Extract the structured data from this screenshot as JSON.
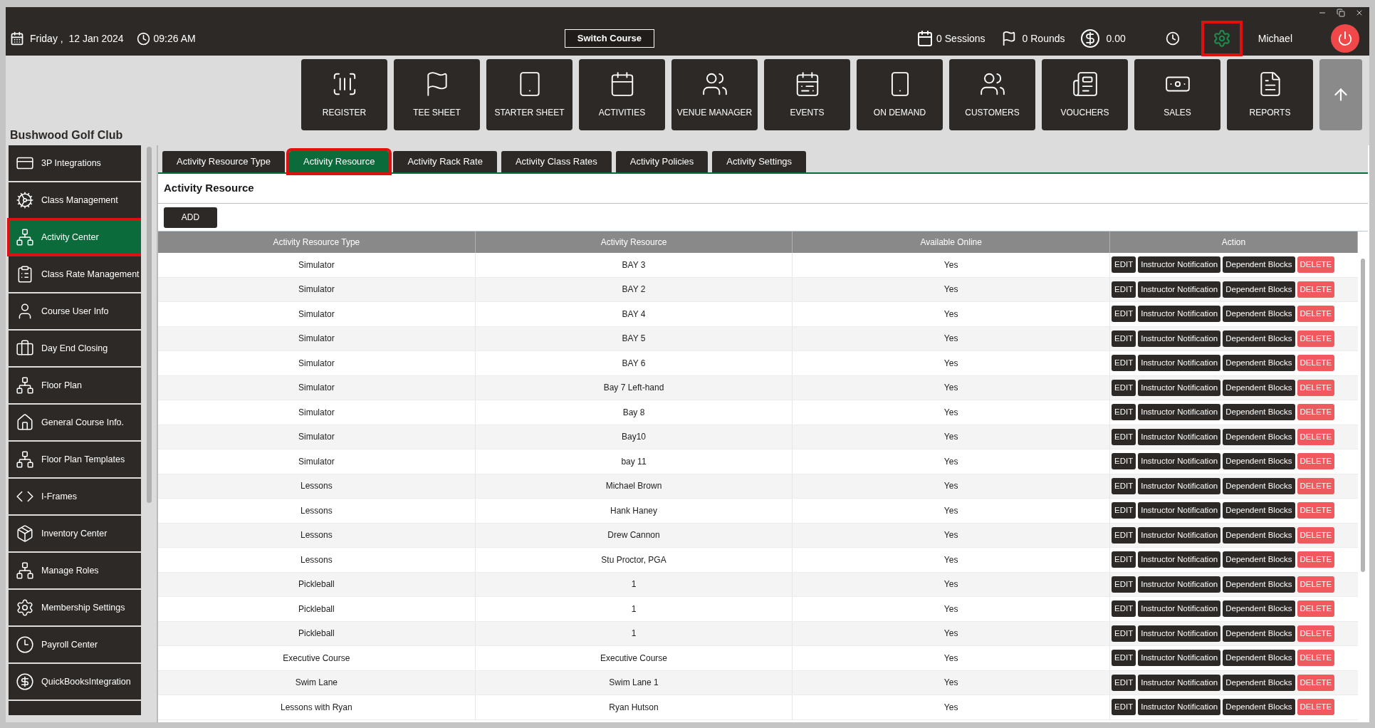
{
  "top_bar": {
    "date": "Friday ,  12 Jan 2024",
    "time": "09:26 AM",
    "switch_course": "Switch Course",
    "sessions": "0 Sessions",
    "rounds": "0 Rounds",
    "balance": "0.00",
    "settings_highlighted": true,
    "user": "Michael"
  },
  "toolbar": [
    {
      "label": "REGISTER",
      "kind": "scanner"
    },
    {
      "label": "TEE SHEET",
      "kind": "flag"
    },
    {
      "label": "STARTER SHEET",
      "kind": "tablet"
    },
    {
      "label": "ACTIVITIES",
      "kind": "calendar"
    },
    {
      "label": "VENUE MANAGER",
      "kind": "people"
    },
    {
      "label": "EVENTS",
      "kind": "events"
    },
    {
      "label": "ON DEMAND",
      "kind": "phone"
    },
    {
      "label": "CUSTOMERS",
      "kind": "group"
    },
    {
      "label": "VOUCHERS",
      "kind": "voucher"
    },
    {
      "label": "SALES",
      "kind": "sales"
    },
    {
      "label": "REPORTS",
      "kind": "report"
    }
  ],
  "club_name": "Bushwood Golf Club",
  "sidebar": {
    "items": [
      {
        "label": "3P Integrations",
        "kind": "card",
        "selected": false,
        "highlighted": false
      },
      {
        "label": "Class Management",
        "kind": "gear",
        "selected": false,
        "highlighted": false
      },
      {
        "label": "Activity  Center",
        "kind": "tree",
        "selected": true,
        "highlighted": true
      },
      {
        "label": "Class Rate Management",
        "kind": "list",
        "selected": false,
        "highlighted": false
      },
      {
        "label": "Course User Info",
        "kind": "user",
        "selected": false,
        "highlighted": false
      },
      {
        "label": "Day End Closing",
        "kind": "case",
        "selected": false,
        "highlighted": false
      },
      {
        "label": "Floor Plan",
        "kind": "tree",
        "selected": false,
        "highlighted": false
      },
      {
        "label": "General Course Info.",
        "kind": "house",
        "selected": false,
        "highlighted": false
      },
      {
        "label": "Floor Plan Templates",
        "kind": "tree",
        "selected": false,
        "highlighted": false
      },
      {
        "label": "I-Frames",
        "kind": "code",
        "selected": false,
        "highlighted": false
      },
      {
        "label": "Inventory Center",
        "kind": "cart",
        "selected": false,
        "highlighted": false
      },
      {
        "label": "Manage Roles",
        "kind": "tree",
        "selected": false,
        "highlighted": false
      },
      {
        "label": "Membership Settings",
        "kind": "gear2",
        "selected": false,
        "highlighted": false
      },
      {
        "label": "Payroll Center",
        "kind": "clock",
        "selected": false,
        "highlighted": false
      },
      {
        "label": "QuickBooksIntegration",
        "kind": "qb",
        "selected": false,
        "highlighted": false
      }
    ]
  },
  "tabs": [
    {
      "label": "Activity Resource Type",
      "selected": false,
      "highlighted": false
    },
    {
      "label": "Activity Resource",
      "selected": true,
      "highlighted": true
    },
    {
      "label": "Activity Rack Rate",
      "selected": false,
      "highlighted": false
    },
    {
      "label": "Activity Class Rates",
      "selected": false,
      "highlighted": false
    },
    {
      "label": "Activity Policies",
      "selected": false,
      "highlighted": false
    },
    {
      "label": "Activity Settings",
      "selected": false,
      "highlighted": false
    }
  ],
  "panel": {
    "title": "Activity Resource",
    "add_button": "ADD"
  },
  "table": {
    "columns": [
      "Activity Resource Type",
      "Activity Resource",
      "Available Online",
      "Action"
    ],
    "rows": [
      {
        "cells": [
          "Simulator",
          "BAY 3",
          "Yes"
        ],
        "actions": [
          {
            "label": "EDIT",
            "kind": "dark"
          },
          {
            "label": "Instructor Notification",
            "kind": "dark"
          },
          {
            "label": "Dependent Blocks",
            "kind": "dark"
          },
          {
            "label": "DELETE",
            "kind": "danger"
          }
        ]
      },
      {
        "cells": [
          "Simulator",
          "BAY 2",
          "Yes"
        ],
        "actions": [
          {
            "label": "EDIT",
            "kind": "dark"
          },
          {
            "label": "Instructor Notification",
            "kind": "dark"
          },
          {
            "label": "Dependent Blocks",
            "kind": "dark"
          },
          {
            "label": "DELETE",
            "kind": "danger"
          }
        ]
      },
      {
        "cells": [
          "Simulator",
          "BAY 4",
          "Yes"
        ],
        "actions": [
          {
            "label": "EDIT",
            "kind": "dark"
          },
          {
            "label": "Instructor Notification",
            "kind": "dark"
          },
          {
            "label": "Dependent Blocks",
            "kind": "dark"
          },
          {
            "label": "DELETE",
            "kind": "danger"
          }
        ]
      },
      {
        "cells": [
          "Simulator",
          "BAY 5",
          "Yes"
        ],
        "actions": [
          {
            "label": "EDIT",
            "kind": "dark"
          },
          {
            "label": "Instructor Notification",
            "kind": "dark"
          },
          {
            "label": "Dependent Blocks",
            "kind": "dark"
          },
          {
            "label": "DELETE",
            "kind": "danger"
          }
        ]
      },
      {
        "cells": [
          "Simulator",
          "BAY 6",
          "Yes"
        ],
        "actions": [
          {
            "label": "EDIT",
            "kind": "dark"
          },
          {
            "label": "Instructor Notification",
            "kind": "dark"
          },
          {
            "label": "Dependent Blocks",
            "kind": "dark"
          },
          {
            "label": "DELETE",
            "kind": "danger"
          }
        ]
      },
      {
        "cells": [
          "Simulator",
          "Bay 7 Left-hand",
          "Yes"
        ],
        "actions": [
          {
            "label": "EDIT",
            "kind": "dark"
          },
          {
            "label": "Instructor Notification",
            "kind": "dark"
          },
          {
            "label": "Dependent Blocks",
            "kind": "dark"
          },
          {
            "label": "DELETE",
            "kind": "danger"
          }
        ]
      },
      {
        "cells": [
          "Simulator",
          "Bay 8",
          "Yes"
        ],
        "actions": [
          {
            "label": "EDIT",
            "kind": "dark"
          },
          {
            "label": "Instructor Notification",
            "kind": "dark"
          },
          {
            "label": "Dependent Blocks",
            "kind": "dark"
          },
          {
            "label": "DELETE",
            "kind": "danger"
          }
        ]
      },
      {
        "cells": [
          "Simulator",
          "Bay10",
          "Yes"
        ],
        "actions": [
          {
            "label": "EDIT",
            "kind": "dark"
          },
          {
            "label": "Instructor Notification",
            "kind": "dark"
          },
          {
            "label": "Dependent Blocks",
            "kind": "dark"
          },
          {
            "label": "DELETE",
            "kind": "danger"
          }
        ]
      },
      {
        "cells": [
          "Simulator",
          "bay 11",
          "Yes"
        ],
        "actions": [
          {
            "label": "EDIT",
            "kind": "dark"
          },
          {
            "label": "Instructor Notification",
            "kind": "dark"
          },
          {
            "label": "Dependent Blocks",
            "kind": "dark"
          },
          {
            "label": "DELETE",
            "kind": "danger"
          }
        ]
      },
      {
        "cells": [
          "Lessons",
          "Michael Brown",
          "Yes"
        ],
        "actions": [
          {
            "label": "EDIT",
            "kind": "dark"
          },
          {
            "label": "Instructor Notification",
            "kind": "dark"
          },
          {
            "label": "Dependent Blocks",
            "kind": "dark"
          },
          {
            "label": "DELETE",
            "kind": "danger"
          }
        ]
      },
      {
        "cells": [
          "Lessons",
          "Hank Haney",
          "Yes"
        ],
        "actions": [
          {
            "label": "EDIT",
            "kind": "dark"
          },
          {
            "label": "Instructor Notification",
            "kind": "dark"
          },
          {
            "label": "Dependent Blocks",
            "kind": "dark"
          },
          {
            "label": "DELETE",
            "kind": "danger"
          }
        ]
      },
      {
        "cells": [
          "Lessons",
          "Drew Cannon",
          "Yes"
        ],
        "actions": [
          {
            "label": "EDIT",
            "kind": "dark"
          },
          {
            "label": "Instructor Notification",
            "kind": "dark"
          },
          {
            "label": "Dependent Blocks",
            "kind": "dark"
          },
          {
            "label": "DELETE",
            "kind": "danger"
          }
        ]
      },
      {
        "cells": [
          "Lessons",
          "Stu Proctor, PGA",
          "Yes"
        ],
        "actions": [
          {
            "label": "EDIT",
            "kind": "dark"
          },
          {
            "label": "Instructor Notification",
            "kind": "dark"
          },
          {
            "label": "Dependent Blocks",
            "kind": "dark"
          },
          {
            "label": "DELETE",
            "kind": "danger"
          }
        ]
      },
      {
        "cells": [
          "Pickleball",
          "1",
          "Yes"
        ],
        "actions": [
          {
            "label": "EDIT",
            "kind": "dark"
          },
          {
            "label": "Instructor Notification",
            "kind": "dark"
          },
          {
            "label": "Dependent Blocks",
            "kind": "dark"
          },
          {
            "label": "DELETE",
            "kind": "danger"
          }
        ]
      },
      {
        "cells": [
          "Pickleball",
          "1",
          "Yes"
        ],
        "actions": [
          {
            "label": "EDIT",
            "kind": "dark"
          },
          {
            "label": "Instructor Notification",
            "kind": "dark"
          },
          {
            "label": "Dependent Blocks",
            "kind": "dark"
          },
          {
            "label": "DELETE",
            "kind": "danger"
          }
        ]
      },
      {
        "cells": [
          "Pickleball",
          "1",
          "Yes"
        ],
        "actions": [
          {
            "label": "EDIT",
            "kind": "dark"
          },
          {
            "label": "Instructor Notification",
            "kind": "dark"
          },
          {
            "label": "Dependent Blocks",
            "kind": "dark"
          },
          {
            "label": "DELETE",
            "kind": "danger"
          }
        ]
      },
      {
        "cells": [
          "Executive Course",
          "Executive Course",
          "Yes"
        ],
        "actions": [
          {
            "label": "EDIT",
            "kind": "dark"
          },
          {
            "label": "Instructor Notification",
            "kind": "dark"
          },
          {
            "label": "Dependent Blocks",
            "kind": "dark"
          },
          {
            "label": "DELETE",
            "kind": "danger"
          }
        ]
      },
      {
        "cells": [
          "Swim Lane",
          "Swim Lane 1",
          "Yes"
        ],
        "actions": [
          {
            "label": "EDIT",
            "kind": "dark"
          },
          {
            "label": "Instructor Notification",
            "kind": "dark"
          },
          {
            "label": "Dependent Blocks",
            "kind": "dark"
          },
          {
            "label": "DELETE",
            "kind": "danger"
          }
        ]
      },
      {
        "cells": [
          "Lessons with Ryan",
          "Ryan Hutson",
          "Yes"
        ],
        "actions": [
          {
            "label": "EDIT",
            "kind": "dark"
          },
          {
            "label": "Instructor Notification",
            "kind": "dark"
          },
          {
            "label": "Dependent Blocks",
            "kind": "dark"
          },
          {
            "label": "DELETE",
            "kind": "danger"
          }
        ]
      }
    ]
  }
}
